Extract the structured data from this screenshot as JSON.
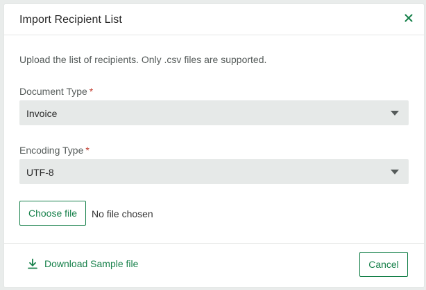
{
  "dialog": {
    "title": "Import Recipient List",
    "description": "Upload the list of recipients. Only .csv files are supported."
  },
  "document_type": {
    "label": "Document Type",
    "required_mark": "*",
    "selected": "Invoice"
  },
  "encoding_type": {
    "label": "Encoding Type",
    "required_mark": "*",
    "selected": "UTF-8"
  },
  "file_input": {
    "button_label": "Choose file",
    "status": "No file chosen"
  },
  "footer": {
    "download_label": "Download Sample file",
    "cancel_label": "Cancel"
  },
  "icons": {
    "close": "close-icon",
    "caret": "caret-down-icon",
    "download": "download-icon"
  },
  "colors": {
    "accent": "#16804a",
    "required": "#c0392b",
    "select_bg": "#e6e9e8"
  }
}
